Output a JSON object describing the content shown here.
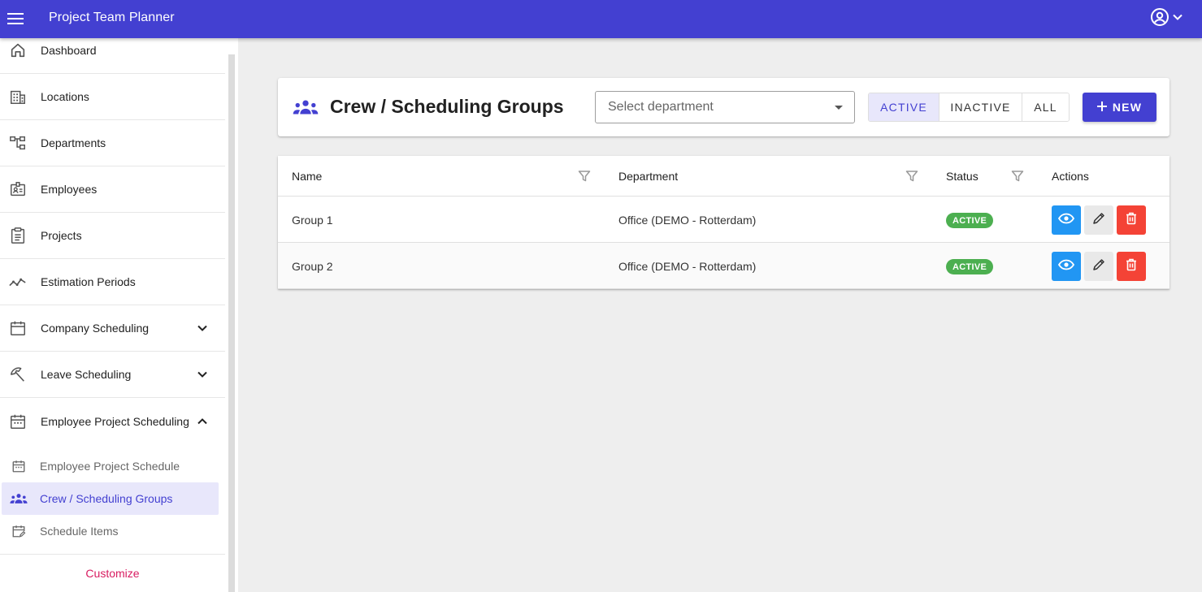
{
  "app": {
    "title": "Project Team Planner"
  },
  "topbar": {
    "menu_icon": "hamburger-menu-icon",
    "account_icon": "account-circle-icon"
  },
  "sidebar": {
    "items": [
      {
        "label": "Dashboard",
        "icon": "home-icon"
      },
      {
        "label": "Locations",
        "icon": "building-icon"
      },
      {
        "label": "Departments",
        "icon": "hierarchy-icon"
      },
      {
        "label": "Employees",
        "icon": "id-badge-icon"
      },
      {
        "label": "Projects",
        "icon": "clipboard-icon"
      },
      {
        "label": "Estimation Periods",
        "icon": "trend-line-icon"
      },
      {
        "label": "Company Scheduling",
        "icon": "calendar-icon",
        "expandable": true,
        "expanded": false
      },
      {
        "label": "Leave Scheduling",
        "icon": "beach-umbrella-icon",
        "expandable": true,
        "expanded": false
      },
      {
        "label": "Employee Project Scheduling",
        "icon": "calendar-icon",
        "expandable": true,
        "expanded": true
      }
    ],
    "subitems": [
      {
        "label": "Employee Project Schedule",
        "icon": "calendar-small-icon",
        "active": false
      },
      {
        "label": "Crew / Scheduling Groups",
        "icon": "groups-icon",
        "active": true
      },
      {
        "label": "Schedule Items",
        "icon": "calendar-edit-icon",
        "active": false
      }
    ],
    "customize_label": "Customize"
  },
  "page": {
    "title": "Crew / Scheduling Groups",
    "title_icon": "groups-icon",
    "department_select": {
      "placeholder": "Select department",
      "value": ""
    },
    "status_filter": {
      "options": [
        "ACTIVE",
        "INACTIVE",
        "ALL"
      ],
      "selected": "ACTIVE"
    },
    "new_button": "NEW"
  },
  "table": {
    "columns": [
      "Name",
      "Department",
      "Status",
      "Actions"
    ],
    "rows": [
      {
        "name": "Group 1",
        "department": "Office (DEMO - Rotterdam)",
        "status": "ACTIVE"
      },
      {
        "name": "Group 2",
        "department": "Office (DEMO - Rotterdam)",
        "status": "ACTIVE"
      }
    ]
  },
  "colors": {
    "primary": "#4340d1",
    "active_badge": "#4caf50",
    "view_button": "#2196f3",
    "delete_button": "#f44336",
    "customize_link": "#d81b60"
  }
}
